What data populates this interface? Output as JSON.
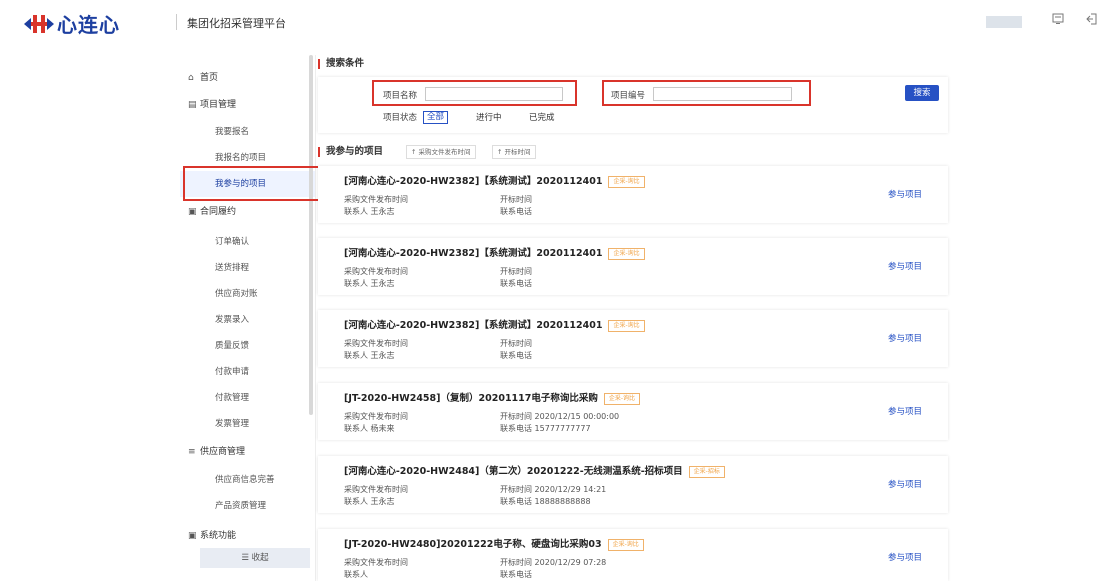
{
  "header": {
    "logo_text": "心连心",
    "platform_title": "集团化招采管理平台",
    "icons": [
      "message-icon",
      "logout-icon"
    ]
  },
  "sidebar": {
    "items": [
      {
        "label": "首页",
        "icon": "home-icon",
        "level": "top"
      },
      {
        "label": "项目管理",
        "icon": "folder-icon",
        "level": "top"
      },
      {
        "label": "我要报名",
        "level": "sub"
      },
      {
        "label": "我报名的项目",
        "level": "sub"
      },
      {
        "label": "我参与的项目",
        "level": "sub",
        "active": true
      },
      {
        "label": "合同履约",
        "icon": "contract-icon",
        "level": "top"
      },
      {
        "label": "订单确认",
        "level": "sub"
      },
      {
        "label": "送货排程",
        "level": "sub"
      },
      {
        "label": "供应商对账",
        "level": "sub"
      },
      {
        "label": "发票录入",
        "level": "sub"
      },
      {
        "label": "质量反馈",
        "level": "sub"
      },
      {
        "label": "付款申请",
        "level": "sub"
      },
      {
        "label": "付款管理",
        "level": "sub"
      },
      {
        "label": "发票管理",
        "level": "sub"
      },
      {
        "label": "供应商管理",
        "icon": "list-icon",
        "level": "top"
      },
      {
        "label": "供应商信息完善",
        "level": "sub"
      },
      {
        "label": "产品资质管理",
        "level": "sub"
      },
      {
        "label": "系统功能",
        "icon": "system-icon",
        "level": "top"
      }
    ],
    "collapse_label": "收起"
  },
  "search": {
    "section_title": "搜索条件",
    "project_name_label": "项目名称",
    "project_name_value": "",
    "project_no_label": "项目编号",
    "project_no_value": "",
    "status_label": "项目状态",
    "status_options": [
      "全部",
      "进行中",
      "已完成"
    ],
    "status_selected": "全部",
    "search_button": "搜索"
  },
  "list": {
    "section_title": "我参与的项目",
    "sort_buttons": [
      "↑ 采购文件发布时间",
      "↑ 开标时间"
    ],
    "publish_label": "采购文件发布时间",
    "open_label": "开标时间",
    "contact_label": "联系人",
    "phone_label": "联系电话",
    "join_label": "参与项目",
    "projects": [
      {
        "title": "[河南心连心-2020-HW2382]【系统测试】2020112401",
        "tag": "企采-询比",
        "open_time": "",
        "contact": "王永志",
        "phone": ""
      },
      {
        "title": "[河南心连心-2020-HW2382]【系统测试】2020112401",
        "tag": "企采-询比",
        "open_time": "",
        "contact": "王永志",
        "phone": ""
      },
      {
        "title": "[河南心连心-2020-HW2382]【系统测试】2020112401",
        "tag": "企采-询比",
        "open_time": "",
        "contact": "王永志",
        "phone": ""
      },
      {
        "title": "[JT-2020-HW2458]（复制）20201117电子称询比采购",
        "tag": "企采-询比",
        "open_time": "2020/12/15 00:00:00",
        "contact": "杨未来",
        "phone": "15777777777"
      },
      {
        "title": "[河南心连心-2020-HW2484]（第二次）20201222-无线测温系统-招标项目",
        "tag": "企采-招标",
        "open_time": "2020/12/29 14:21",
        "contact": "王永志",
        "phone": "18888888888"
      },
      {
        "title": "[JT-2020-HW2480]20201222电子称、硬盘询比采购03",
        "tag": "企采-询比",
        "open_time": "2020/12/29 07:28",
        "contact": "",
        "phone": ""
      }
    ]
  }
}
